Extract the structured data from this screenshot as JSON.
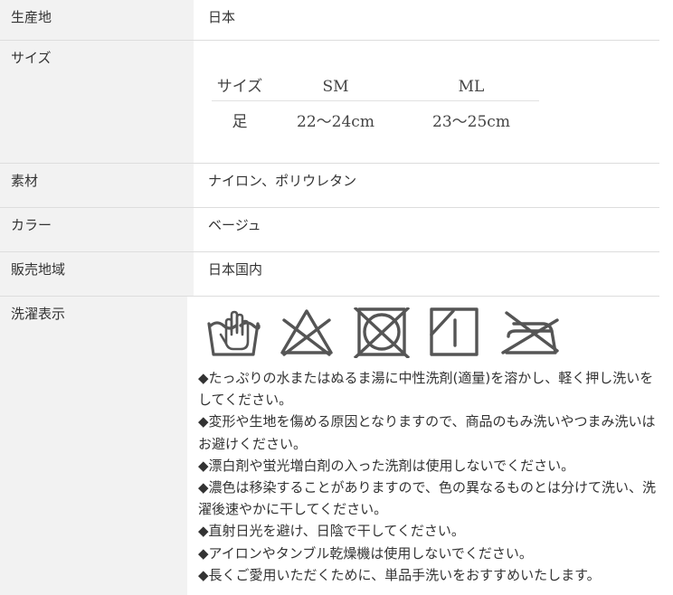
{
  "rows": {
    "origin": {
      "label": "生産地",
      "value": "日本"
    },
    "size": {
      "label": "サイズ",
      "table": {
        "header": [
          "サイズ",
          "SM",
          "ML"
        ],
        "row": [
          "足",
          "22～24cm",
          "23～25cm"
        ]
      }
    },
    "material": {
      "label": "素材",
      "value": "ナイロン、ポリウレタン"
    },
    "color": {
      "label": "カラー",
      "value": "ベージュ"
    },
    "area": {
      "label": "販売地域",
      "value": "日本国内"
    },
    "wash": {
      "label": "洗濯表示",
      "icons": [
        "hand-wash-icon",
        "no-bleach-icon",
        "no-tumble-dry-icon",
        "drip-dry-shade-icon",
        "no-iron-icon"
      ],
      "notes": [
        "◆たっぷりの水またはぬるま湯に中性洗剤(適量)を溶かし、軽く押し洗いをしてください。",
        "◆変形や生地を傷める原因となりますので、商品のもみ洗いやつまみ洗いはお避けください。",
        "◆漂白剤や蛍光増白剤の入った洗剤は使用しないでください。",
        "◆濃色は移染することがありますので、色の異なるものとは分けて洗い、洗濯後速やかに干してください。",
        "◆直射日光を避け、日陰で干してください。",
        "◆アイロンやタンブル乾燥機は使用しないでください。",
        "◆長くご愛用いただくために、単品手洗いをおすすめいたします。"
      ]
    }
  },
  "colors": {
    "label_bg": "#f2f2f2",
    "border": "#dddddd",
    "text": "#333333",
    "icon": "#555555"
  }
}
